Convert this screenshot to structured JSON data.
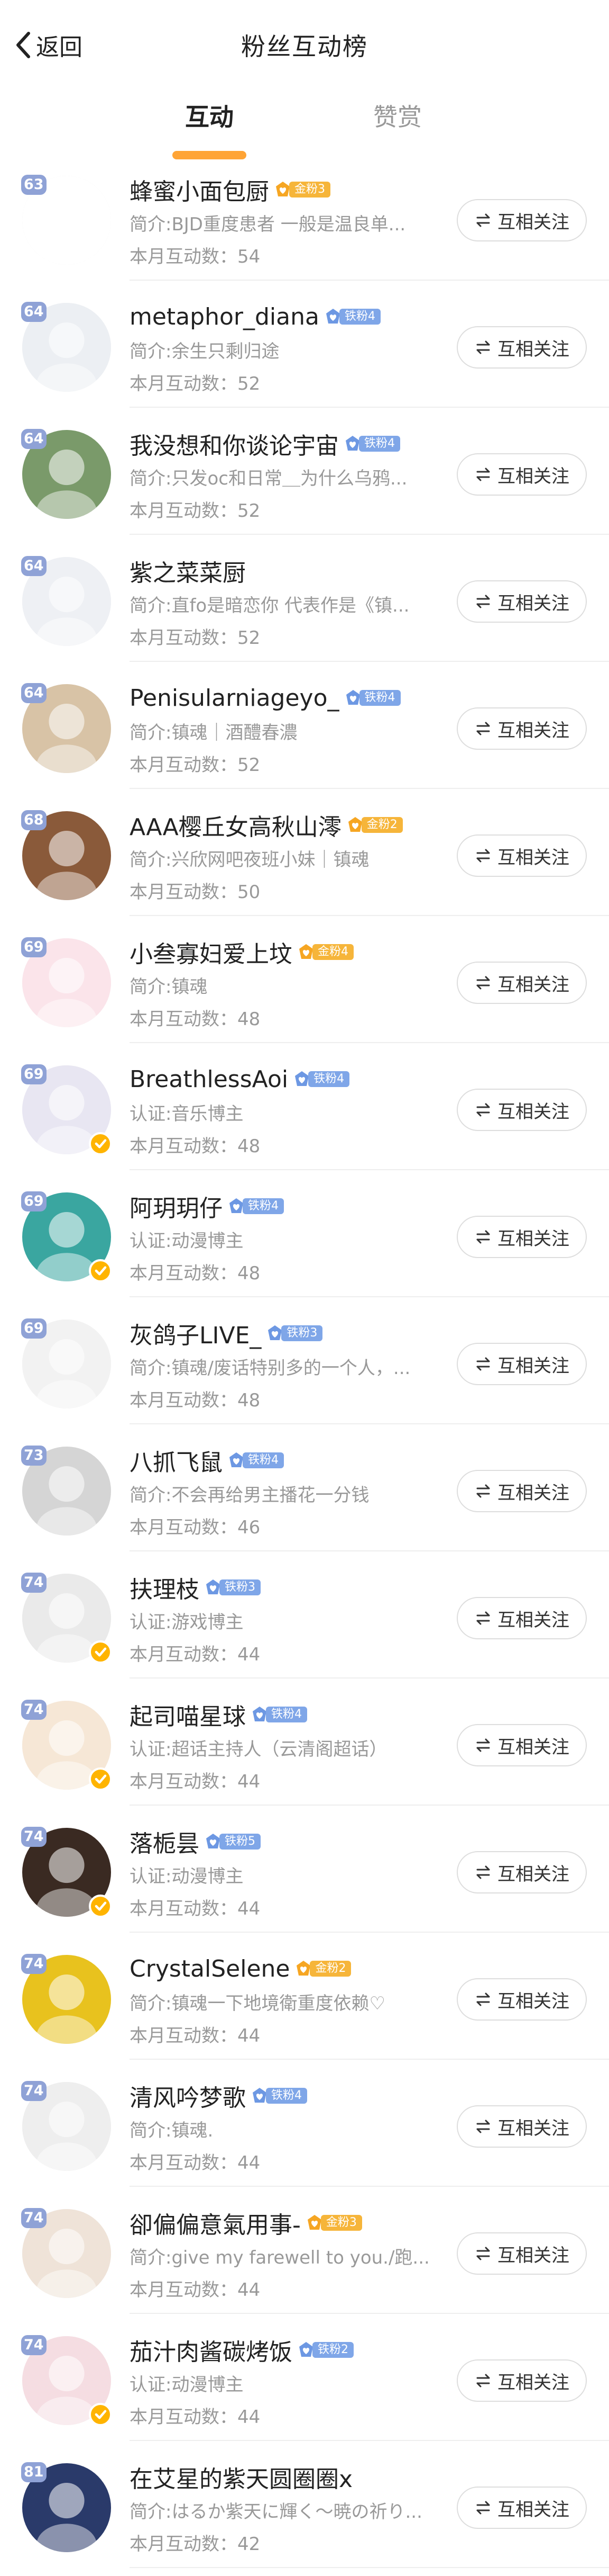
{
  "header": {
    "back_label": "返回",
    "title": "粉丝互动榜"
  },
  "tabs": [
    {
      "label": "互动"
    },
    {
      "label": "赞赏"
    }
  ],
  "colors": {
    "accent": "#ff9a1f",
    "gold_badge": "#f6b53a",
    "iron_badge": "#7fa6e8",
    "verified": "#ffb400"
  },
  "follow_label": "互相关注",
  "count_prefix": "本月互动数：",
  "fans": [
    {
      "level": "63",
      "name": "蜂蜜小面包厨",
      "badge": "金粉3",
      "badge_type": "gold",
      "desc": "简介:BJD重度患者 一般是温良单...",
      "count": "54",
      "verified": false,
      "avatar_color": "#ffffff",
      "avatar_icon": "cartoon-bear-avatar"
    },
    {
      "level": "64",
      "name": "metaphor_diana",
      "badge": "铁粉4",
      "badge_type": "iron",
      "desc": "简介:余生只剩归途",
      "count": "52",
      "verified": false,
      "avatar_color": "#eceff3",
      "avatar_icon": "anime-girl-avatar"
    },
    {
      "level": "64",
      "name": "我没想和你谈论宇宙",
      "badge": "铁粉4",
      "badge_type": "iron",
      "desc": "简介:只发oc和日常＿为什么乌鸦...",
      "count": "52",
      "verified": false,
      "avatar_color": "#7a9a6a",
      "avatar_icon": "doll-photo-avatar"
    },
    {
      "level": "64",
      "name": "紫之菜菜厨",
      "badge": "",
      "badge_type": "",
      "desc": "简介:直fo是暗恋你 代表作是《镇...",
      "count": "52",
      "verified": false,
      "avatar_color": "#eef0f4",
      "avatar_icon": "anime-girl-avatar"
    },
    {
      "level": "64",
      "name": "Penisularniageyo_",
      "badge": "铁粉4",
      "badge_type": "iron",
      "desc": "简介:镇魂｜酒醴春濃",
      "count": "52",
      "verified": false,
      "avatar_color": "#d8c3a6",
      "avatar_icon": "fabric-avatar"
    },
    {
      "level": "68",
      "name": "AAA樱丘女高秋山澪",
      "badge": "金粉2",
      "badge_type": "gold",
      "desc": "简介:兴欣网吧夜班小妹｜镇魂",
      "count": "50",
      "verified": false,
      "avatar_color": "#8a5a3a",
      "avatar_icon": "photo-avatar"
    },
    {
      "level": "69",
      "name": "小叁寡妇爱上坟",
      "badge": "金粉4",
      "badge_type": "gold",
      "desc": "简介:镇魂",
      "count": "48",
      "verified": false,
      "avatar_color": "#fbe4ea",
      "avatar_icon": "cartoon-dogs-avatar"
    },
    {
      "level": "69",
      "name": "BreathlessAoi",
      "badge": "铁粉4",
      "badge_type": "iron",
      "desc": "认证:音乐博主",
      "count": "48",
      "verified": true,
      "avatar_color": "#e8e6f2",
      "avatar_icon": "anime-girl-avatar"
    },
    {
      "level": "69",
      "name": "阿玥玥仔",
      "badge": "铁粉4",
      "badge_type": "iron",
      "desc": "认证:动漫博主",
      "count": "48",
      "verified": true,
      "avatar_color": "#3aa6a0",
      "avatar_icon": "figure-photo-avatar"
    },
    {
      "level": "69",
      "name": "灰鸽子LIVE_",
      "badge": "铁粉3",
      "badge_type": "iron",
      "desc": "简介:镇魂/废话特别多的一个人，...",
      "count": "48",
      "verified": false,
      "avatar_color": "#f2f2f2",
      "avatar_icon": "manga-avatar"
    },
    {
      "level": "73",
      "name": "八抓飞鼠",
      "badge": "铁粉4",
      "badge_type": "iron",
      "desc": "简介:不会再给男主播花一分钱",
      "count": "46",
      "verified": false,
      "avatar_color": "#d5d5d5",
      "avatar_icon": "default-avatar"
    },
    {
      "level": "74",
      "name": "扶理枝",
      "badge": "铁粉3",
      "badge_type": "iron",
      "desc": "认证:游戏博主",
      "count": "44",
      "verified": true,
      "avatar_color": "#eaeaea",
      "avatar_icon": "manga-avatar"
    },
    {
      "level": "74",
      "name": "起司喵星球",
      "badge": "铁粉4",
      "badge_type": "iron",
      "desc": "认证:超话主持人（云清阁超话）",
      "count": "44",
      "verified": true,
      "avatar_color": "#f6e7d6",
      "avatar_icon": "anime-girl-avatar"
    },
    {
      "level": "74",
      "name": "落栀昙",
      "badge": "铁粉5",
      "badge_type": "iron",
      "desc": "认证:动漫博主",
      "count": "44",
      "verified": true,
      "avatar_color": "#3a2a22",
      "avatar_icon": "cosplay-photo-avatar"
    },
    {
      "level": "74",
      "name": "CrystalSelene",
      "badge": "金粉2",
      "badge_type": "gold",
      "desc": "简介:镇魂一下地境衛重度依赖♡",
      "count": "44",
      "verified": false,
      "avatar_color": "#e8c21e",
      "avatar_icon": "illustration-avatar"
    },
    {
      "level": "74",
      "name": "清风吟梦歌",
      "badge": "铁粉4",
      "badge_type": "iron",
      "desc": "简介:镇魂.",
      "count": "44",
      "verified": false,
      "avatar_color": "#eeeeee",
      "avatar_icon": "manga-avatar"
    },
    {
      "level": "74",
      "name": "卻偏偏意氣用事-",
      "badge": "金粉3",
      "badge_type": "gold",
      "desc": "简介:give my farewell to you./跑...",
      "count": "44",
      "verified": false,
      "avatar_color": "#efe3d8",
      "avatar_icon": "anime-boy-avatar"
    },
    {
      "level": "74",
      "name": "茄汁肉酱碳烤饭",
      "badge": "铁粉2",
      "badge_type": "iron",
      "desc": "认证:动漫博主",
      "count": "44",
      "verified": true,
      "avatar_color": "#f5dde2",
      "avatar_icon": "anime-girl-avatar"
    },
    {
      "level": "81",
      "name": "在艾星的紫天圆圈圈x",
      "badge": "",
      "badge_type": "",
      "desc": "简介:はるか紫天に輝く～暁の祈り...",
      "count": "42",
      "verified": false,
      "avatar_color": "#2a3a6a",
      "avatar_icon": "anime-girl-avatar"
    }
  ]
}
